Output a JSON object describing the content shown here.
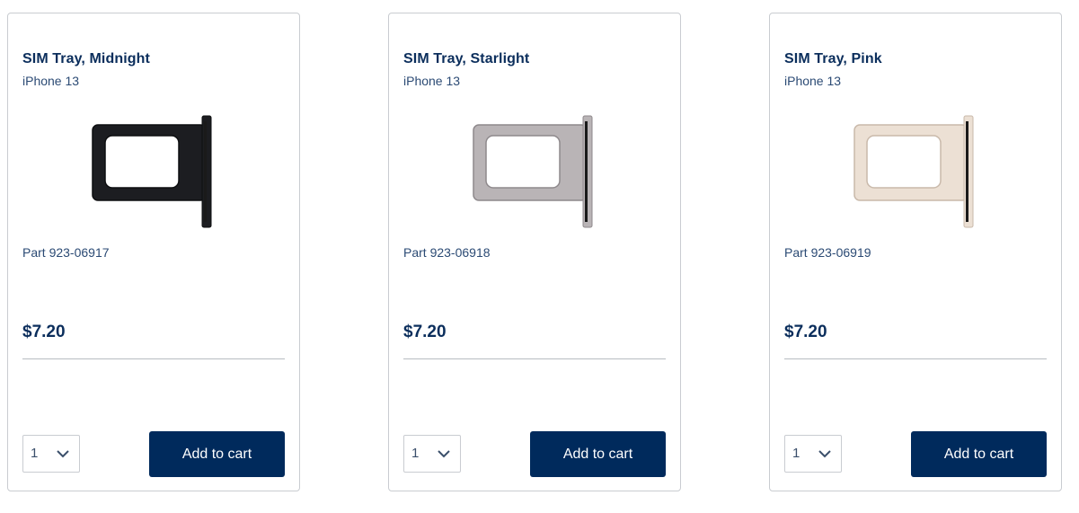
{
  "products": [
    {
      "title": "SIM Tray, Midnight",
      "model": "iPhone 13",
      "part": "Part 923-06917",
      "price": "$7.20",
      "quantity": "1",
      "button_label": "Add to cart",
      "tray_color": "#1c1d21",
      "tray_edge": "#0d0e10"
    },
    {
      "title": "SIM Tray, Starlight",
      "model": "iPhone 13",
      "part": "Part 923-06918",
      "price": "$7.20",
      "quantity": "1",
      "button_label": "Add to cart",
      "tray_color": "#b9b4b6",
      "tray_edge": "#8e898c"
    },
    {
      "title": "SIM Tray, Pink",
      "model": "iPhone 13",
      "part": "Part 923-06919",
      "price": "$7.20",
      "quantity": "1",
      "button_label": "Add to cart",
      "tray_color": "#ece0d4",
      "tray_edge": "#c9b9aa"
    }
  ],
  "colors": {
    "brand_navy": "#002a5c",
    "text_navy": "#0b2e5c",
    "border": "#c9ccd1"
  }
}
